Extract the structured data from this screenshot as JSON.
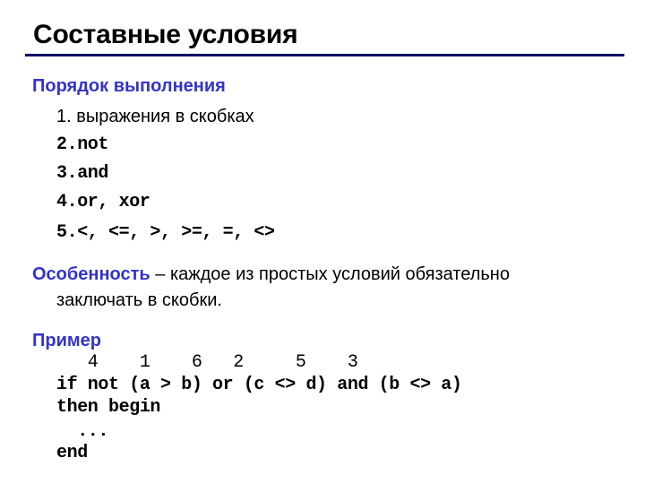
{
  "slide": {
    "title": "Составные условия",
    "accent_color": "#3333cc",
    "rule_color": "#000066"
  },
  "order_section": {
    "heading": "Порядок выполнения",
    "items": [
      "1. выражения в скобках",
      "2.not",
      "3.and",
      "4.or, xor",
      "5.<, <=, >, >=, =, <>"
    ]
  },
  "feature_section": {
    "heading": "Особенность",
    "text_line1": " – каждое из простых условий обязательно",
    "text_line2": "заключать в скобки."
  },
  "example_section": {
    "heading": "Пример",
    "order_numbers_line": "   4    1    6   2     5    3",
    "code_lines": [
      "if not (a > b) or (c <> d) and (b <> a)",
      "then begin",
      "  ...",
      "end"
    ]
  }
}
